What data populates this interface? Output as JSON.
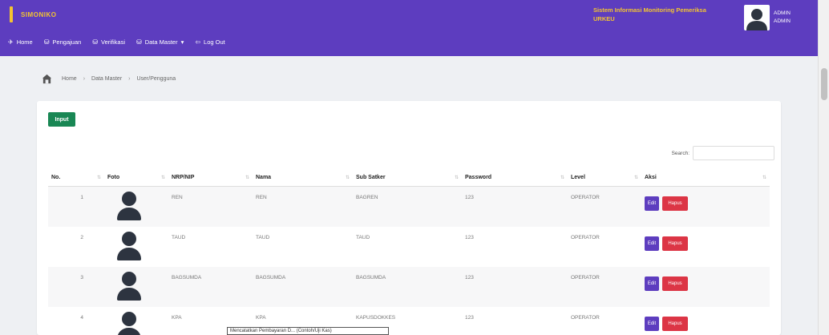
{
  "header": {
    "app_name": "SIMONIKO",
    "system_title": "Sistem Informasi Monitoring Pemeriksa",
    "system_subtitle": "URKEU",
    "user_name": "ADMIN",
    "user_role": "ADMIN",
    "colors": {
      "primary": "#5d3dbf",
      "accent": "#f4c430"
    }
  },
  "nav": {
    "items": [
      {
        "icon": "home-icon",
        "label": "Home"
      },
      {
        "icon": "report-icon",
        "label": "Pengajuan"
      },
      {
        "icon": "check-icon",
        "label": "Verifikasi"
      },
      {
        "icon": "database-icon",
        "label": "Data Master"
      },
      {
        "icon": "logout-icon",
        "label": "Log Out"
      }
    ]
  },
  "breadcrumb": [
    "Home",
    "Data Master",
    "User/Pengguna"
  ],
  "toolbar": {
    "input_label": "Input",
    "search_label": "Search:",
    "search_value": ""
  },
  "table": {
    "headers": [
      "No.",
      "Foto",
      "NRP/NIP",
      "Nama",
      "Sub Satker",
      "Password",
      "Level",
      "Aksi"
    ],
    "rows": [
      {
        "no": "1",
        "nrp": "REN",
        "nama": "REN",
        "sub": "BAGREN",
        "pass": "123",
        "level": "OPERATOR"
      },
      {
        "no": "2",
        "nrp": "TAUD",
        "nama": "TAUD",
        "sub": "TAUD",
        "pass": "123",
        "level": "OPERATOR"
      },
      {
        "no": "3",
        "nrp": "BAGSUMDA",
        "nama": "BAGSUMDA",
        "sub": "BAGSUMDA",
        "pass": "123",
        "level": "OPERATOR"
      },
      {
        "no": "4",
        "nrp": "KPA",
        "nama": "KPA",
        "sub": "KAPUSDOKKES",
        "pass": "123",
        "level": "OPERATOR"
      }
    ],
    "edit_label": "Edit",
    "hapus_label": "Hapus"
  },
  "tooltip": "Mencatatkan Pembayaran D... (Contoh/Uji Kas)"
}
